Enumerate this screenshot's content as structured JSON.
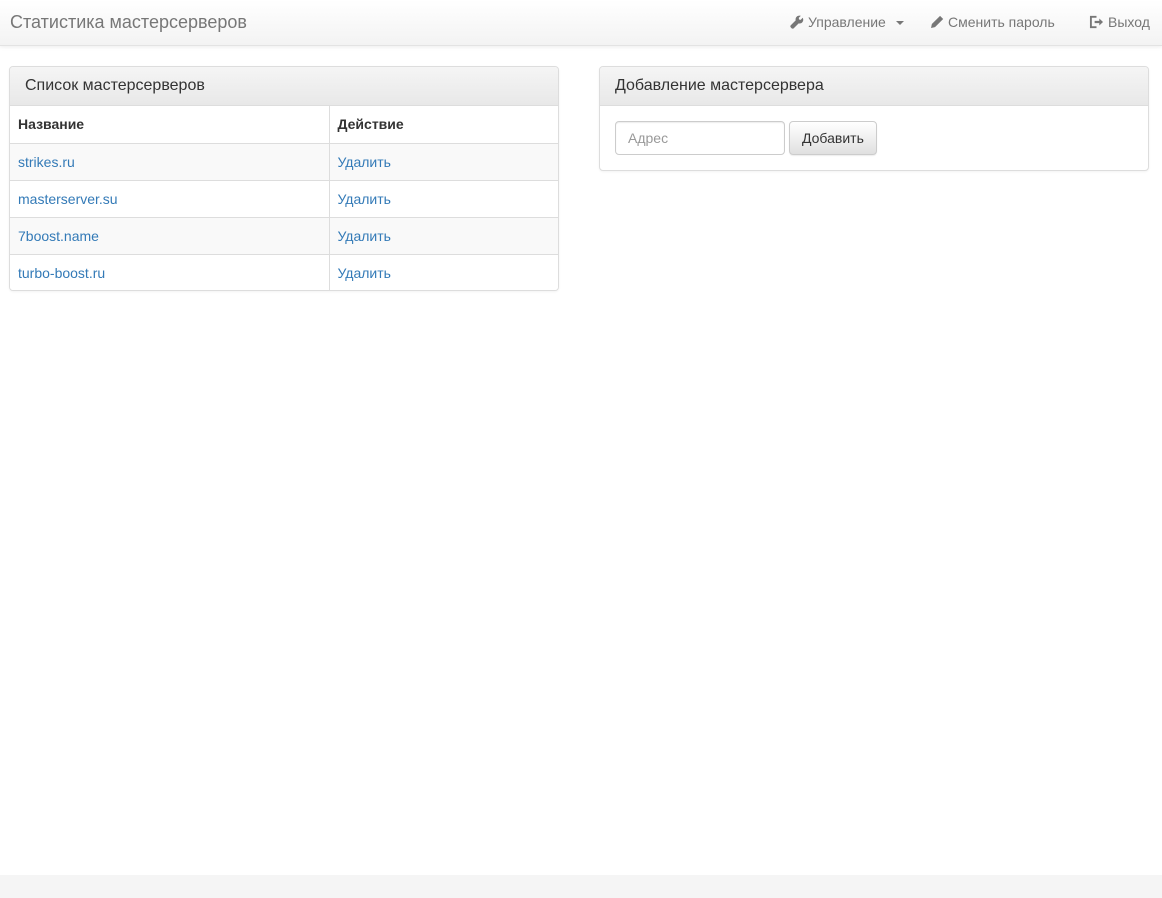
{
  "navbar": {
    "brand": "Статистика мастерсерверов",
    "items": [
      {
        "label": "Управление",
        "icon": "wrench-icon"
      },
      {
        "label": "Сменить пароль",
        "icon": "pencil-icon"
      },
      {
        "label": "Выход",
        "icon": "logout-icon"
      }
    ]
  },
  "list_panel": {
    "title": "Список мастерсерверов",
    "columns": [
      "Название",
      "Действие"
    ],
    "rows": [
      {
        "name": "strikes.ru",
        "action": "Удалить"
      },
      {
        "name": "masterserver.su",
        "action": "Удалить"
      },
      {
        "name": "7boost.name",
        "action": "Удалить"
      },
      {
        "name": "turbo-boost.ru",
        "action": "Удалить"
      }
    ]
  },
  "add_panel": {
    "title": "Добавление мастерсервера",
    "input_placeholder": "Адрес",
    "input_value": "",
    "button_label": "Добавить"
  },
  "colors": {
    "link": "#337ab7",
    "nav_text": "#777777"
  }
}
